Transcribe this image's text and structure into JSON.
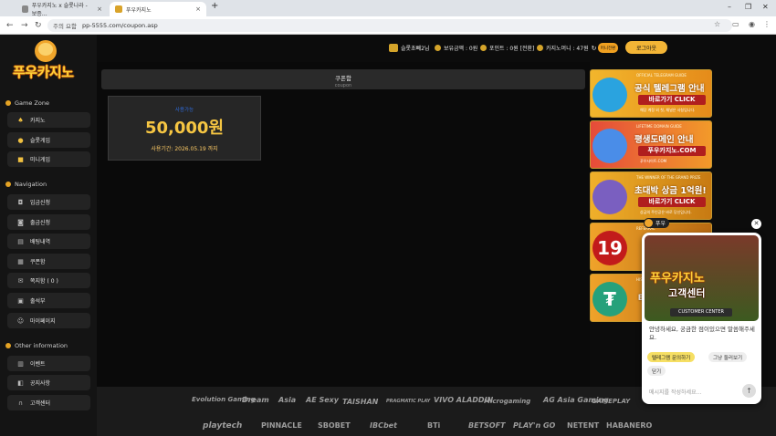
{
  "browser": {
    "tabs": [
      {
        "label": "푸우카지노 x 슬롯나라 - 보증…"
      },
      {
        "label": "푸우카지노"
      }
    ],
    "url_security": "주의 요함",
    "url": "pp-5555.com/coupon.asp"
  },
  "brand": {
    "logo_text": "푸우카지노"
  },
  "sidebar": {
    "game_zone_title": "Game Zone",
    "game_items": [
      {
        "label": "카지노",
        "icon": "spade-icon"
      },
      {
        "label": "슬롯게임",
        "icon": "coins-icon"
      },
      {
        "label": "미니게임",
        "icon": "gamepad-icon"
      }
    ],
    "navigation_title": "Navigation",
    "nav_items": [
      {
        "label": "입금신청",
        "icon": "deposit-icon"
      },
      {
        "label": "출금신청",
        "icon": "withdraw-icon"
      },
      {
        "label": "배팅내역",
        "icon": "history-icon"
      },
      {
        "label": "쿠폰함",
        "icon": "coupon-icon"
      },
      {
        "label": "쪽지함 ( 0 )",
        "icon": "mail-icon"
      },
      {
        "label": "출석부",
        "icon": "calendar-icon"
      },
      {
        "label": "마이페이지",
        "icon": "user-icon"
      }
    ],
    "other_title": "Other information",
    "other_items": [
      {
        "label": "이벤트",
        "icon": "gift-icon"
      },
      {
        "label": "공지사항",
        "icon": "notice-icon"
      },
      {
        "label": "고객센터",
        "icon": "headset-icon"
      }
    ]
  },
  "topbar": {
    "user": "슬롯초빼2님",
    "balance": "보유금액 : 0원",
    "points": "포인트 : 0원 [전환]",
    "casino_money": "카지노머니 : 47원",
    "move_label": "머니전환",
    "logout_label": "로그아웃"
  },
  "coupon": {
    "title": "쿠폰함",
    "subtitle": "coupon",
    "card_tag": "사용가능",
    "amount": "50,000원",
    "expiry": "사용기간: 2026.05.19 까지"
  },
  "banners": [
    {
      "sub": "OFFICIAL TELEGRAM GUIDE",
      "title": "공식 텔레그램 안내",
      "button": "바로가기 CLICK",
      "note": "해당 계정 외 첫, 채널은 사칭입니다."
    },
    {
      "sub": "LIFETIME DOMAIN GUIDE",
      "title": "평생도메인 안내",
      "button": "푸우카지노.COM",
      "note": "푸우사이트.COM"
    },
    {
      "sub": "THE WINNER OF THE GRAND PRIZE",
      "title": "초대박 상금 1억원!",
      "button": "바로가기 CLICK",
      "note": "상금의 주인공은 바로 당신입니다."
    },
    {
      "sub": "REFERRAL",
      "title": "19",
      "button": "",
      "note": ""
    },
    {
      "sub": "HISTORY",
      "title": "테",
      "button": "",
      "note": ""
    }
  ],
  "providers_row1": [
    "Evolution Gaming",
    "Dream",
    "Asia",
    "AE Sexy",
    "TAISHAN",
    "PRAGMATIC PLAY",
    "VIVO ALADDIN",
    "Microgaming",
    "AG Asia Gaming",
    "GAMEPLAY"
  ],
  "providers_row2": [
    "playtech",
    "PINNACLE",
    "SBOBET",
    "IBCbet",
    "BTi",
    "BETSOFT",
    "PLAY'n GO",
    "NETENT",
    "HABANERO"
  ],
  "chat": {
    "agent": "푸우",
    "banner_title": "푸우카지노",
    "banner_sub": "고객센터",
    "banner_cc": "CUSTOMER CENTER",
    "message": "안녕하세요, 궁금한 점이있으면 말씀해주세요.",
    "chip_telegram": "텔레그램 문의하기",
    "chip_browse": "그냥 둘러보기",
    "chip_close": "닫기",
    "input_placeholder": "메시지를 작성하세요..."
  }
}
